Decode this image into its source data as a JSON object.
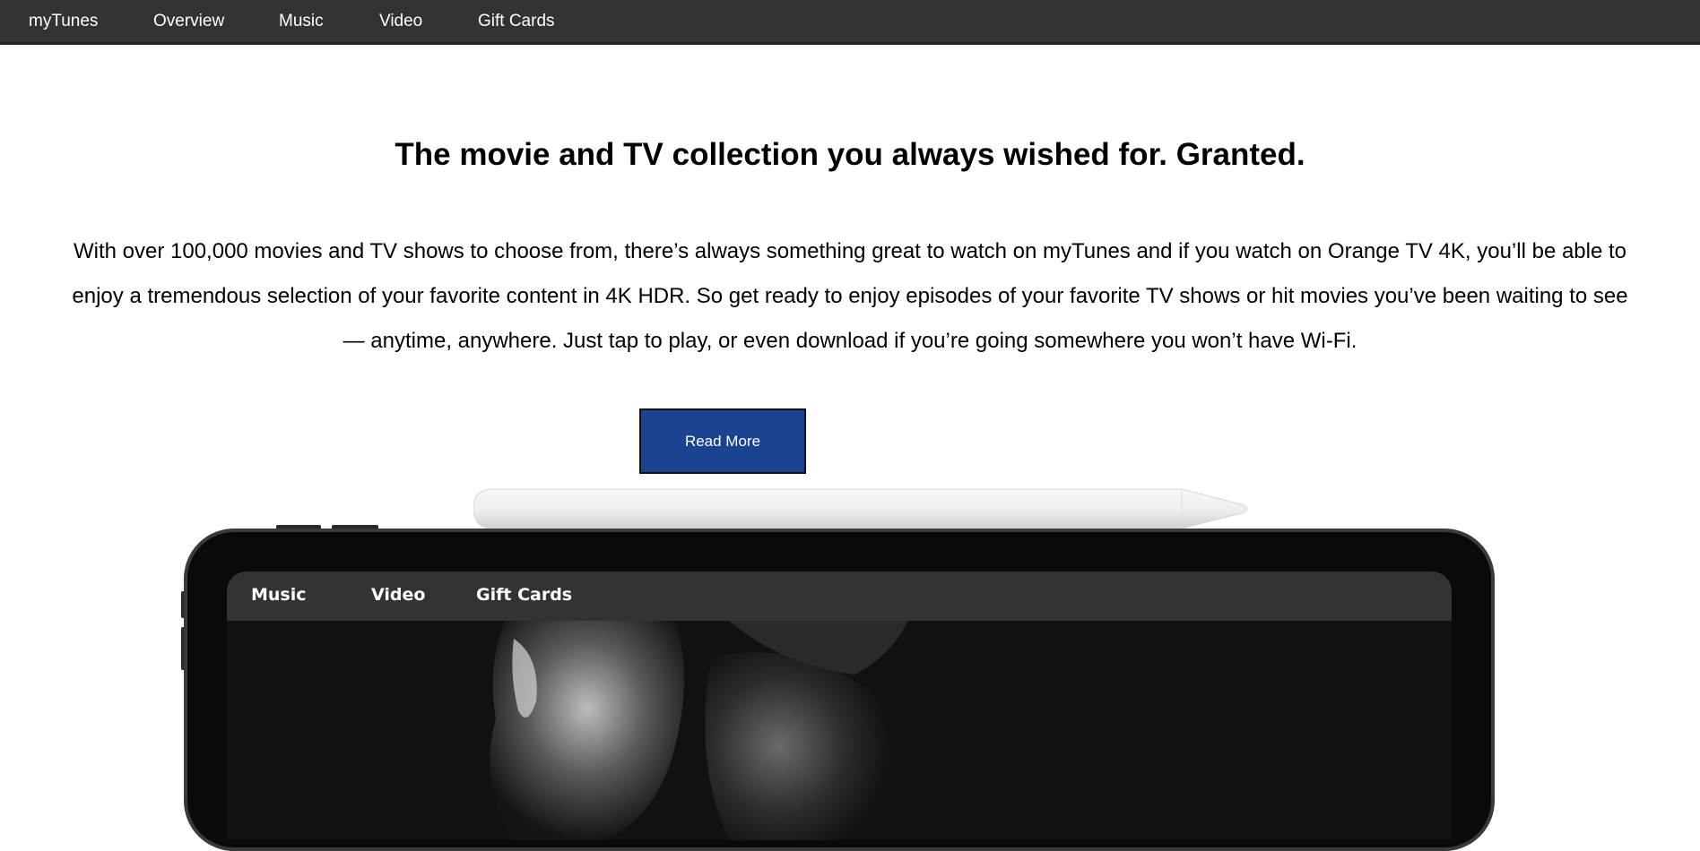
{
  "nav": {
    "brand": "myTunes",
    "items": [
      {
        "label": "Overview"
      },
      {
        "label": "Music"
      },
      {
        "label": "Video"
      },
      {
        "label": "Gift Cards"
      }
    ]
  },
  "hero": {
    "headline": "The movie and TV collection you always wished for. Granted.",
    "body": "With over 100,000 movies and TV shows to choose from, there’s always something great to watch on myTunes and if you watch on Orange TV 4K, you’ll be able to enjoy a tremendous selection of your favorite content in 4K HDR. So get ready to enjoy episodes of your favorite TV shows or hit movies you’ve been waiting to see — anytime, anywhere. Just tap to play, or even download if you’re going somewhere you won’t have Wi-Fi.",
    "button_label": "Read More"
  },
  "device_screen": {
    "nav_items": [
      {
        "label": "Music"
      },
      {
        "label": "Video"
      },
      {
        "label": "Gift Cards"
      }
    ]
  },
  "colors": {
    "nav_background": "#333333",
    "button_background": "#1a4490",
    "button_text": "#ffffff"
  }
}
